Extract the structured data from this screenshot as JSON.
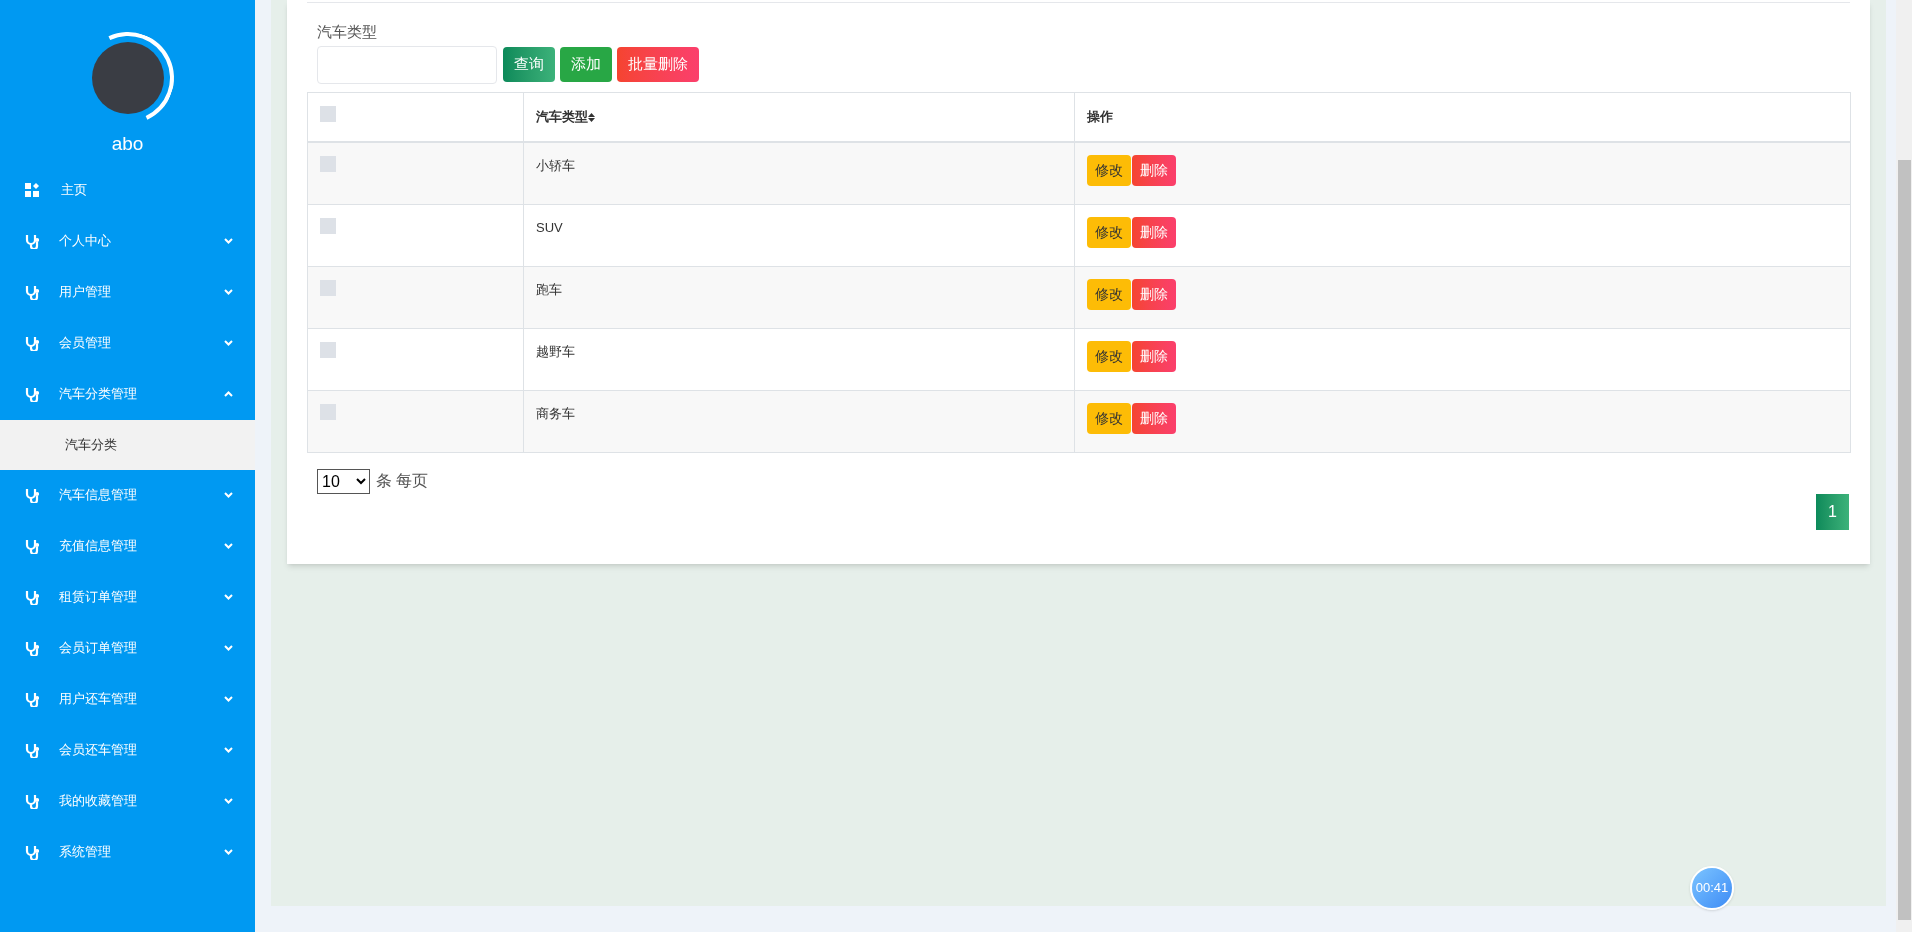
{
  "sidebar": {
    "username": "abo",
    "menu": [
      {
        "kind": "home",
        "label": "主页"
      },
      {
        "kind": "group",
        "label": "个人中心",
        "expanded": false
      },
      {
        "kind": "group",
        "label": "用户管理",
        "expanded": false
      },
      {
        "kind": "group",
        "label": "会员管理",
        "expanded": false
      },
      {
        "kind": "group",
        "label": "汽车分类管理",
        "expanded": true,
        "children": [
          {
            "label": "汽车分类",
            "selected": true
          }
        ]
      },
      {
        "kind": "group",
        "label": "汽车信息管理",
        "expanded": false
      },
      {
        "kind": "group",
        "label": "充值信息管理",
        "expanded": false
      },
      {
        "kind": "group",
        "label": "租赁订单管理",
        "expanded": false
      },
      {
        "kind": "group",
        "label": "会员订单管理",
        "expanded": false
      },
      {
        "kind": "group",
        "label": "用户还车管理",
        "expanded": false
      },
      {
        "kind": "group",
        "label": "会员还车管理",
        "expanded": false
      },
      {
        "kind": "group",
        "label": "我的收藏管理",
        "expanded": false
      },
      {
        "kind": "group",
        "label": "系统管理",
        "expanded": false
      }
    ]
  },
  "search": {
    "label": "汽车类型",
    "buttons": [
      {
        "kind": "query",
        "label": "查询"
      },
      {
        "kind": "add",
        "label": "添加"
      },
      {
        "kind": "batch_delete",
        "label": "批量删除"
      }
    ]
  },
  "table": {
    "header_checked": false,
    "columns": [
      "汽车类型",
      "操作"
    ],
    "rows": [
      {
        "checked": false,
        "type": "小轿车",
        "actions": [
          "修改",
          "删除"
        ]
      },
      {
        "checked": false,
        "type": "SUV",
        "actions": [
          "修改",
          "删除"
        ]
      },
      {
        "checked": false,
        "type": "跑车",
        "actions": [
          "修改",
          "删除"
        ]
      },
      {
        "checked": false,
        "type": "越野车",
        "actions": [
          "修改",
          "删除"
        ]
      },
      {
        "checked": false,
        "type": "商务车",
        "actions": [
          "修改",
          "删除"
        ]
      }
    ]
  },
  "pagination": {
    "page_size": "10",
    "page_size_label": "条 每页",
    "pages": [
      {
        "label": "1",
        "selected": true
      }
    ]
  },
  "timer": "00:41"
}
